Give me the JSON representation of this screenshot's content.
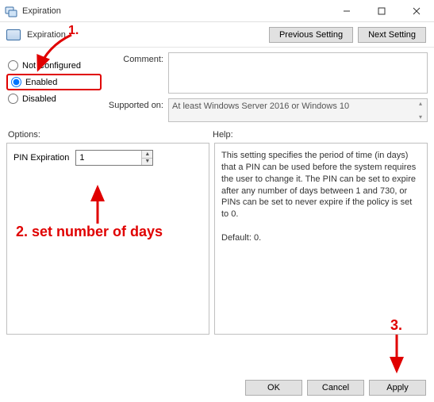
{
  "window": {
    "title": "Expiration"
  },
  "subheader": {
    "title": "Expiration",
    "prev_btn": "Previous Setting",
    "next_btn": "Next Setting"
  },
  "radios": {
    "not_configured": "Not Configured",
    "enabled": "Enabled",
    "disabled": "Disabled",
    "selected": "enabled"
  },
  "labels": {
    "comment": "Comment:",
    "supported": "Supported on:",
    "options": "Options:",
    "help": "Help:",
    "pin_expiration": "PIN Expiration"
  },
  "supported_text": "At least Windows Server 2016 or Windows 10",
  "pin_value": "1",
  "help_text": "This setting specifies the period of time (in days) that a PIN can be used before the system requires the user to change it. The PIN can be set to expire after any number of days between 1 and 730, or PINs can be set to never expire if the policy is set to 0.",
  "help_default": "Default: 0.",
  "buttons": {
    "ok": "OK",
    "cancel": "Cancel",
    "apply": "Apply"
  },
  "annotations": {
    "a1": "1.",
    "a2": "2. set number of days",
    "a3": "3."
  }
}
